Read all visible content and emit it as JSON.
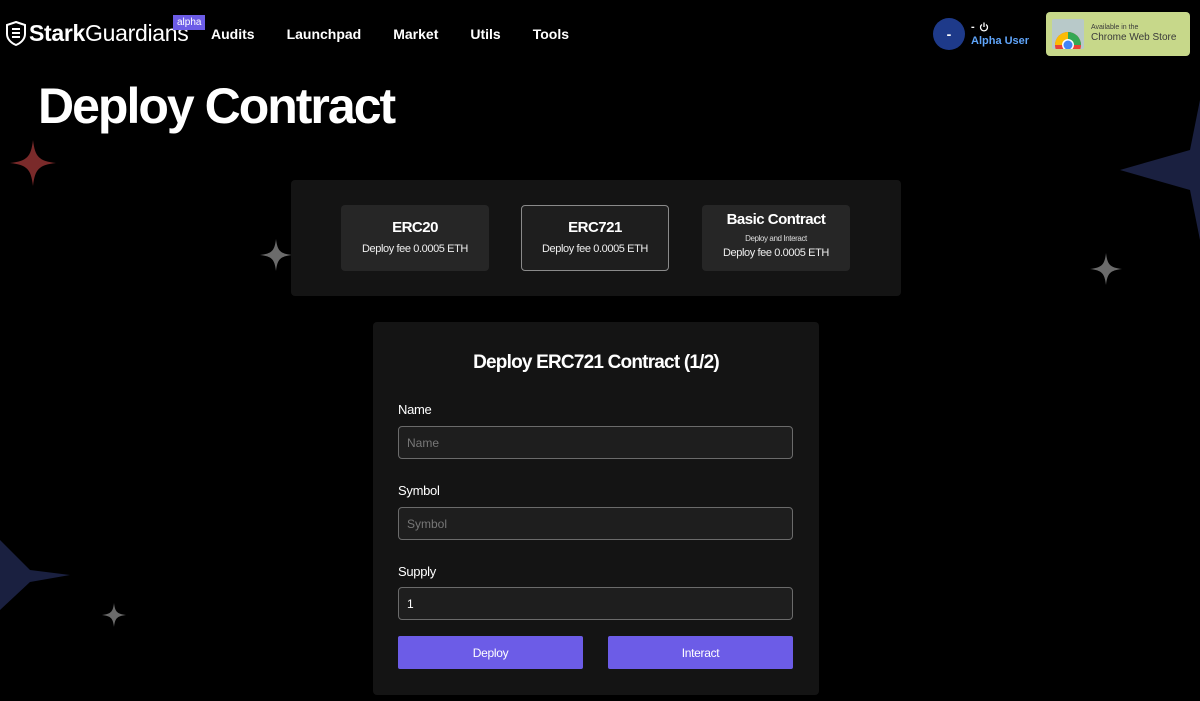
{
  "header": {
    "logo": {
      "part1": "Stark",
      "part2": "Guardians"
    },
    "badge": "alpha",
    "nav": [
      "Audits",
      "Launchpad",
      "Market",
      "Utils",
      "Tools"
    ],
    "user": {
      "avatar": "-",
      "balance": "-",
      "name": "Alpha User",
      "power_icon": "power-icon"
    },
    "chrome_store": {
      "line1": "Available in the",
      "line2": "Chrome Web Store"
    }
  },
  "page_title": "Deploy Contract",
  "contract_types": [
    {
      "title": "ERC20",
      "fee": "Deploy fee 0.0005 ETH",
      "subtitle": ""
    },
    {
      "title": "ERC721",
      "fee": "Deploy fee 0.0005 ETH",
      "subtitle": ""
    },
    {
      "title": "Basic Contract",
      "subtitle": "Deploy and Interact",
      "fee": "Deploy fee 0.0005 ETH"
    }
  ],
  "selected_type": "ERC721",
  "form": {
    "title": "Deploy ERC721 Contract (1/2)",
    "fields": [
      {
        "label": "Name",
        "placeholder": "Name",
        "value": ""
      },
      {
        "label": "Symbol",
        "placeholder": "Symbol",
        "value": ""
      },
      {
        "label": "Supply",
        "placeholder": "",
        "value": "1"
      }
    ],
    "buttons": {
      "deploy": "Deploy",
      "interact": "Interact"
    }
  },
  "colors": {
    "accent": "#6c5ce7",
    "avatar": "#1e3a8a",
    "user_name": "#60a5fa",
    "panel": "#141414",
    "card": "#262626"
  }
}
